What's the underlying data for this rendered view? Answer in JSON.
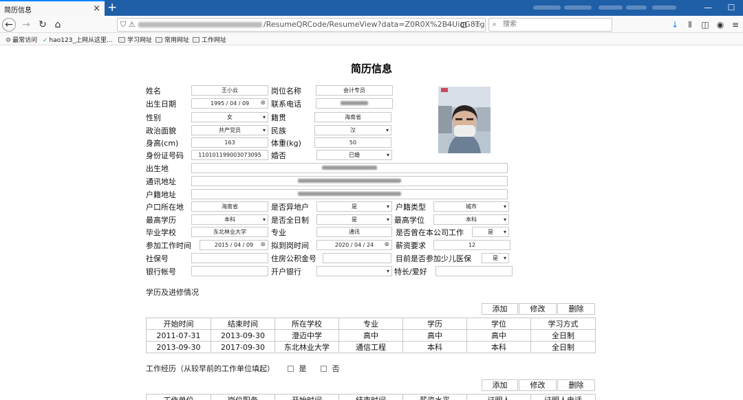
{
  "browser": {
    "tab_title": "简历信息",
    "url_path": "/ResumeQRCode/ResumeView?data=Z0R0X%2B4UiqG8Tg",
    "search_placeholder": "搜索",
    "bookmarks": [
      "最常访问",
      "hao123_上网从这里...",
      "学习网址",
      "常用网址",
      "工作网址"
    ]
  },
  "page": {
    "title": "简历信息"
  },
  "form": {
    "name_label": "姓名",
    "name_value": "王小云",
    "position_label": "岗位名称",
    "position_value": "会计专员",
    "birth_label": "出生日期",
    "birth_value": "1995 / 04 / 09",
    "phone_label": "联系电话",
    "gender_label": "性别",
    "gender_value": "女",
    "native_label": "籍贯",
    "native_value": "海南省",
    "political_label": "政治面貌",
    "political_value": "共产党员",
    "ethnic_label": "民族",
    "ethnic_value": "汉",
    "height_label": "身高(cm)",
    "height_value": "163",
    "weight_label": "体重(kg)",
    "weight_value": "50",
    "idcard_label": "身份证号码",
    "idcard_value": "110101199003073095",
    "marital_label": "婚否",
    "marital_value": "已婚",
    "birthplace_label": "出生地",
    "address_label": "通讯地址",
    "hukou_addr_label": "户籍地址",
    "hukou_loc_label": "户口所在地",
    "hukou_loc_value": "海南省",
    "nonlocal_label": "是否异地户",
    "nonlocal_value": "是",
    "hukou_type_label": "户籍类型",
    "hukou_type_value": "城市",
    "edu_label": "最高学历",
    "edu_value": "本科",
    "fulltime_label": "是否全日制",
    "fulltime_value": "是",
    "degree_label": "最高学位",
    "degree_value": "本科",
    "school_label": "毕业学校",
    "school_value": "东北林业大学",
    "major_label": "专业",
    "major_value": "通讯",
    "worked_here_label": "是否曾在本公司工作",
    "worked_here_value": "是",
    "work_start_label": "参加工作时间",
    "work_start_value": "2015 / 04 / 09",
    "arrival_label": "拟到岗时间",
    "arrival_value": "2020 / 04 / 24",
    "salary_label": "薪资要求",
    "salary_value": "12",
    "social_label": "社保号",
    "fund_label": "住房公积金号",
    "child_ins_label": "目前是否参加少儿医保",
    "child_ins_value": "是",
    "bank_acct_label": "银行帐号",
    "bank_label": "开户银行",
    "hobby_label": "特长/爱好"
  },
  "education": {
    "section_title": "学历及进修情况",
    "buttons": {
      "add": "添加",
      "edit": "修改",
      "delete": "删除"
    },
    "headers": [
      "开始时间",
      "结束时间",
      "所在学校",
      "专业",
      "学历",
      "学位",
      "学习方式"
    ],
    "rows": [
      [
        "2011-07-31",
        "2013-09-30",
        "澄迈中学",
        "高中",
        "高中",
        "高中",
        "全日制"
      ],
      [
        "2013-09-30",
        "2017-09-30",
        "东北林业大学",
        "通信工程",
        "本科",
        "本科",
        "全日制"
      ]
    ]
  },
  "work": {
    "section_title": "工作经历（从较早前的工作单位填起）",
    "option_yes": "是",
    "option_no": "否",
    "buttons": {
      "add": "添加",
      "edit": "修改",
      "delete": "删除"
    },
    "headers": [
      "工作单位",
      "岗位职务",
      "开始时间",
      "结束时间",
      "薪资水平",
      "证明人",
      "证明人电话"
    ]
  }
}
